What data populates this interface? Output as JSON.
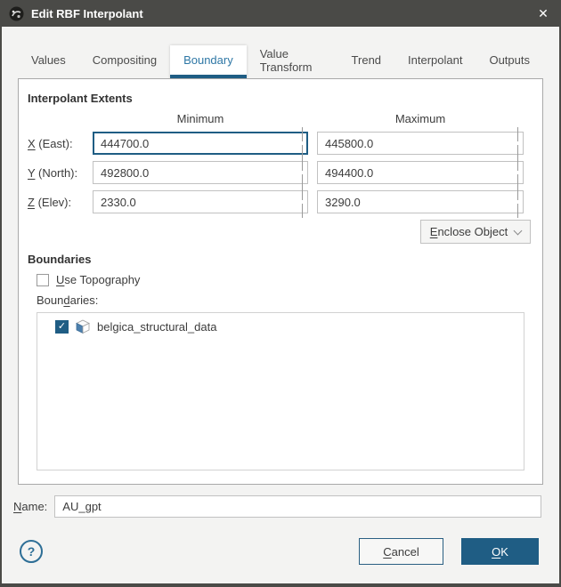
{
  "window": {
    "title": "Edit RBF Interpolant",
    "close_glyph": "✕"
  },
  "tabs": [
    {
      "label": "Values",
      "selected": false
    },
    {
      "label": "Compositing",
      "selected": false
    },
    {
      "label": "Boundary",
      "selected": true
    },
    {
      "label": "Value Transform",
      "selected": false
    },
    {
      "label": "Trend",
      "selected": false
    },
    {
      "label": "Interpolant",
      "selected": false
    },
    {
      "label": "Outputs",
      "selected": false
    }
  ],
  "panel": {
    "extents_heading": "Interpolant Extents",
    "min_header": "Minimum",
    "max_header": "Maximum",
    "rows": [
      {
        "key": "X",
        "post": " (East):",
        "min": "444700.0",
        "max": "445800.0",
        "min_focused": true
      },
      {
        "key": "Y",
        "post": " (North):",
        "min": "492800.0",
        "max": "494400.0",
        "min_focused": false
      },
      {
        "key": "Z",
        "post": " (Elev):",
        "min": "2330.0",
        "max": "3290.0",
        "min_focused": false
      }
    ],
    "enclose_button": {
      "key": "E",
      "post": "nclose Object"
    },
    "boundaries_heading": "Boundaries",
    "use_topography": {
      "key": "U",
      "post": "se Topography",
      "checked": false
    },
    "boundaries_label": {
      "pre": "Boun",
      "key": "d",
      "post": "aries:"
    },
    "list": [
      {
        "label": "belgica_structural_data",
        "checked": true,
        "icon": "mesh-cube-icon",
        "check_glyph": "✓"
      }
    ]
  },
  "name_row": {
    "label": {
      "key": "N",
      "post": "ame:"
    },
    "value": "AU_gpt"
  },
  "footer": {
    "help_glyph": "?",
    "cancel": {
      "key": "C",
      "post": "ancel"
    },
    "ok": {
      "key": "O",
      "post": "K"
    }
  },
  "colors": {
    "accent": "#1f5d84",
    "selected_tab_text": "#2e77a5",
    "titlebar": "#4a4a47",
    "dialog_bg": "#f3f3f2",
    "mesh_icon_blue": "#4d80ad"
  }
}
